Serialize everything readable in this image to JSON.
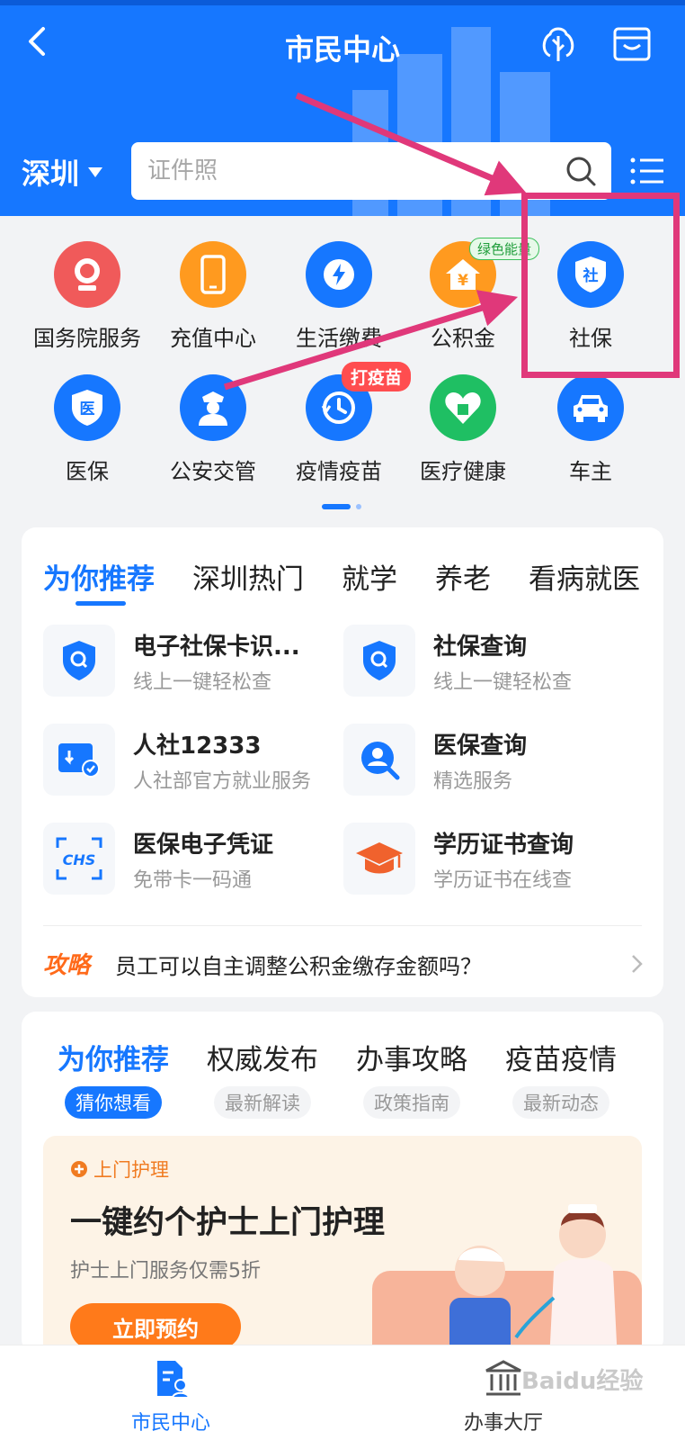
{
  "header": {
    "title": "市民中心",
    "city": "深圳",
    "search_placeholder": "证件照"
  },
  "grid": {
    "items": [
      {
        "label": "国务院服务",
        "icon": "national-emblem-icon",
        "color": "#f05a5a"
      },
      {
        "label": "充值中心",
        "icon": "phone-icon",
        "color": "#ff9a1f"
      },
      {
        "label": "生活缴费",
        "icon": "lightning-icon",
        "color": "#1677ff"
      },
      {
        "label": "公积金",
        "icon": "house-yuan-icon",
        "color": "#ff9a1f"
      },
      {
        "label": "社保",
        "icon": "shield-she-icon",
        "color": "#1677ff"
      },
      {
        "label": "医保",
        "icon": "shield-yi-icon",
        "color": "#1677ff"
      },
      {
        "label": "公安交管",
        "icon": "police-icon",
        "color": "#1677ff"
      },
      {
        "label": "疫情疫苗",
        "icon": "clock-icon",
        "color": "#1677ff"
      },
      {
        "label": "医疗健康",
        "icon": "heart-icon",
        "color": "#1fbf63"
      },
      {
        "label": "车主",
        "icon": "car-icon",
        "color": "#1677ff"
      }
    ],
    "badge_green": "绿色能量",
    "badge_red": "打疫苗",
    "icon_chars": {
      "she": "社",
      "yi": "医",
      "yuan": "¥"
    }
  },
  "recommend": {
    "tabs": [
      "为你推荐",
      "深圳热门",
      "就学",
      "养老",
      "看病就医"
    ],
    "services": [
      {
        "title": "电子社保卡识...",
        "subtitle": "线上一键轻松查",
        "icon": "shield-search-icon"
      },
      {
        "title": "社保查询",
        "subtitle": "线上一键轻松查",
        "icon": "shield-search-icon"
      },
      {
        "title": "人社12333",
        "subtitle": "人社部官方就业服务",
        "icon": "id-card-check-icon"
      },
      {
        "title": "医保查询",
        "subtitle": "精选服务",
        "icon": "person-search-icon"
      },
      {
        "title": "医保电子凭证",
        "subtitle": "免带卡一码通",
        "icon": "chs-scan-icon"
      },
      {
        "title": "学历证书查询",
        "subtitle": "学历证书在线查",
        "icon": "graduation-cap-icon"
      }
    ],
    "chs_text": "CHS",
    "tip_tag": "攻略",
    "tip_text": "员工可以自主调整公积金缴存金额吗？"
  },
  "feed": {
    "tabs": [
      {
        "title": "为你推荐",
        "sub": "猜你想看"
      },
      {
        "title": "权威发布",
        "sub": "最新解读"
      },
      {
        "title": "办事攻略",
        "sub": "政策指南"
      },
      {
        "title": "疫苗疫情",
        "sub": "最新动态"
      }
    ],
    "promo": {
      "tag": "上门护理",
      "title": "一键约个护士上门护理",
      "subtitle": "护士上门服务仅需5折",
      "button": "立即预约"
    }
  },
  "bottom_nav": {
    "items": [
      {
        "label": "市民中心",
        "active": true
      },
      {
        "label": "办事大厅",
        "active": false
      }
    ],
    "watermark": "Baidu经验"
  },
  "colors": {
    "primary": "#1677ff",
    "annotation": "#e0387a",
    "orange": "#ff7a1a"
  }
}
